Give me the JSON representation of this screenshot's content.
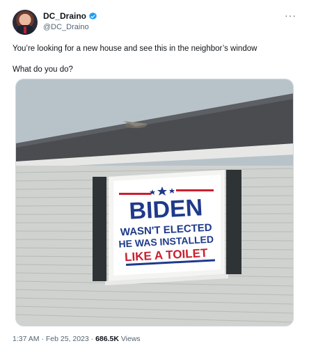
{
  "tweet": {
    "author_name": "DC_Draino",
    "author_handle": "@DC_Draino",
    "text_line1": "You’re looking for a new house and see this in the neighbor’s window",
    "text_line2": "What do you do?",
    "timestamp": "1:37 AM · Feb 25, 2023 · ",
    "views_count": "686.5K",
    "views_label": " Views"
  },
  "sign": {
    "line1": "BIDEN",
    "line2": "WASN'T ELECTED",
    "line3": "HE WAS INSTALLED",
    "line4": "LIKE A TOILET"
  },
  "icons": {
    "verified": "verified-badge-icon",
    "more": "more-options-icon"
  },
  "colors": {
    "verified_blue": "#1d9bf0",
    "sign_navy": "#1f3a8a",
    "sign_red": "#c8202f",
    "siding": "#cfd2cf",
    "roof": "#4a4c50",
    "sky": "#b8c3c9"
  }
}
